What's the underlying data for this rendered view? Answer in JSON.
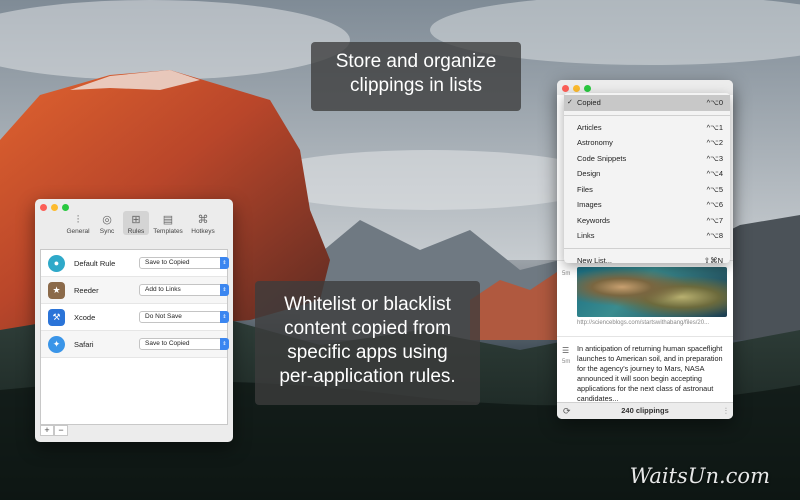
{
  "captions": {
    "top": "Store and organize clippings in lists",
    "middle": "Whitelist or blacklist content copied from specific apps using per-application rules."
  },
  "prefs": {
    "toolbar": [
      {
        "label": "General",
        "icon": "sliders-icon"
      },
      {
        "label": "Sync",
        "icon": "eye-icon"
      },
      {
        "label": "Rules",
        "icon": "rules-icon",
        "active": true
      },
      {
        "label": "Templates",
        "icon": "document-icon"
      },
      {
        "label": "Hotkeys",
        "icon": "keyboard-icon"
      }
    ],
    "rules": [
      {
        "name": "Default Rule",
        "action": "Save to Copied",
        "icon": "default-rule-icon",
        "color": "#2fa9c9"
      },
      {
        "name": "Reeder",
        "action": "Add to Links",
        "icon": "reeder-icon",
        "color": "#8b6a4a"
      },
      {
        "name": "Xcode",
        "action": "Do Not Save",
        "icon": "xcode-icon",
        "color": "#2b74d8"
      },
      {
        "name": "Safari",
        "action": "Save to Copied",
        "icon": "safari-icon",
        "color": "#3a95e8"
      }
    ],
    "add_label": "+",
    "remove_label": "−"
  },
  "menu": {
    "selected": {
      "label": "Copied",
      "shortcut": "^⌥0"
    },
    "lists": [
      {
        "label": "Articles",
        "shortcut": "^⌥1"
      },
      {
        "label": "Astronomy",
        "shortcut": "^⌥2"
      },
      {
        "label": "Code Snippets",
        "shortcut": "^⌥3"
      },
      {
        "label": "Design",
        "shortcut": "^⌥4"
      },
      {
        "label": "Files",
        "shortcut": "^⌥5"
      },
      {
        "label": "Images",
        "shortcut": "^⌥6"
      },
      {
        "label": "Keywords",
        "shortcut": "^⌥7"
      },
      {
        "label": "Links",
        "shortcut": "^⌥8"
      }
    ],
    "new_list": {
      "label": "New List...",
      "shortcut": "⇧⌘N"
    }
  },
  "clippings": {
    "image_card": {
      "age": "5m",
      "url": "http://scienceblogs.com/startswithabang/files/20..."
    },
    "text_card": {
      "age": "5m",
      "text": "In anticipation of returning human spaceflight launches to American soil, and in preparation for the agency's journey to Mars, NASA announced it will soon begin accepting applications for the next class of astronaut candidates..."
    },
    "footer": "240 clippings"
  },
  "watermark": "WaitsUn.com"
}
